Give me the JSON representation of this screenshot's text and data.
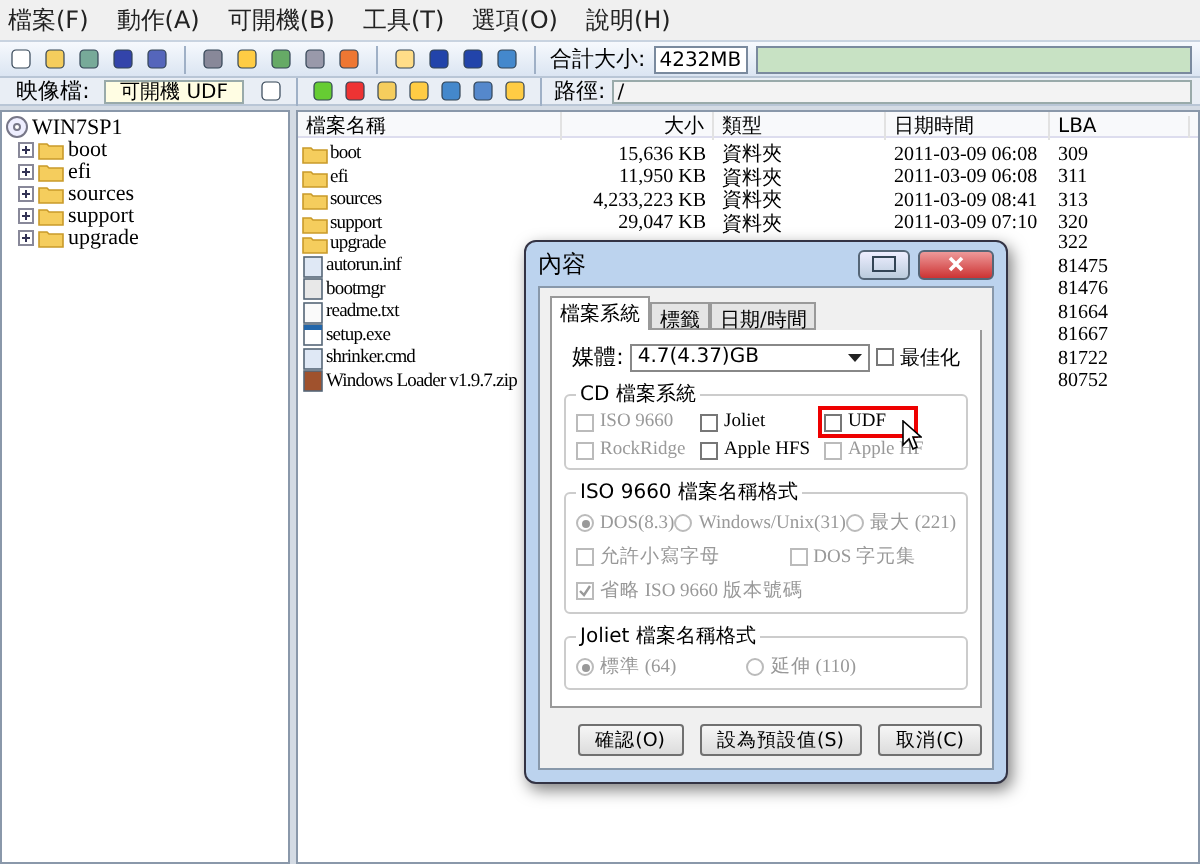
{
  "menu": [
    "檔案(F)",
    "動作(A)",
    "可開機(B)",
    "工具(T)",
    "選項(O)",
    "說明(H)"
  ],
  "toolbar": {
    "total_label": "合計大小:",
    "total_value": "4232MB",
    "level": 1
  },
  "image_bar": {
    "label": "映像檔:",
    "image_type": "可開機 UDF",
    "path_label": "路徑:",
    "path": "/"
  },
  "tree": {
    "label": "WIN7SP1",
    "children": [
      {
        "label": "boot",
        "expanded": false
      },
      {
        "label": "efi",
        "expanded": false
      },
      {
        "label": "sources",
        "expanded": false
      },
      {
        "label": "support",
        "expanded": false
      },
      {
        "label": "upgrade",
        "expanded": false
      }
    ]
  },
  "table": {
    "columns": [
      "檔案名稱",
      "大小",
      "類型",
      "日期時間",
      "LBA"
    ],
    "rows": [
      {
        "kind": "folder",
        "name": "boot",
        "size": "15,636 KB",
        "type": "資料夾",
        "date": "2011-03-09 06:08",
        "lba": "309"
      },
      {
        "kind": "folder",
        "name": "efi",
        "size": "11,950 KB",
        "type": "資料夾",
        "date": "2011-03-09 06:08",
        "lba": "311"
      },
      {
        "kind": "folder",
        "name": "sources",
        "size": "4,233,223 KB",
        "type": "資料夾",
        "date": "2011-03-09 08:41",
        "lba": "313"
      },
      {
        "kind": "folder",
        "name": "support",
        "size": "29,047 KB",
        "type": "資料夾",
        "date": "2011-03-09 07:10",
        "lba": "320"
      },
      {
        "kind": "folder",
        "name": "upgrade",
        "lba": "322"
      },
      {
        "kind": "settings",
        "name": "autorun.inf",
        "lba": "81475"
      },
      {
        "kind": "binary",
        "name": "bootmgr",
        "lba": "81476"
      },
      {
        "kind": "text",
        "name": "readme.txt",
        "lba": "81664"
      },
      {
        "kind": "app",
        "name": "setup.exe",
        "lba": "81667"
      },
      {
        "kind": "script",
        "name": "shrinker.cmd",
        "lba": "81722"
      },
      {
        "kind": "archive",
        "name": "Windows Loader v1.9.7.zip",
        "lba": "80752"
      }
    ]
  },
  "dialog": {
    "title": "內容",
    "tabs": [
      {
        "label": "檔案系統",
        "selected": true
      },
      {
        "label": "標籤",
        "selected": false
      },
      {
        "label": "日期/時間",
        "selected": false
      }
    ],
    "media_label": "媒體:",
    "media_value": "4.7(4.37)GB",
    "optimize": {
      "label": "最佳化",
      "checked": false,
      "disabled": false
    },
    "cd_group": {
      "title": "CD 檔案系統",
      "options": [
        {
          "label": "ISO 9660",
          "checked": false,
          "disabled": true,
          "highlighted": false
        },
        {
          "label": "Joliet",
          "checked": false,
          "disabled": false,
          "highlighted": false
        },
        {
          "label": "UDF",
          "checked": false,
          "disabled": false,
          "highlighted": true
        },
        {
          "label": "RockRidge",
          "checked": false,
          "disabled": true,
          "highlighted": false
        },
        {
          "label": "Apple HFS",
          "checked": false,
          "disabled": false,
          "highlighted": false
        },
        {
          "label": "Apple HF",
          "checked": false,
          "disabled": true,
          "highlighted": false
        }
      ]
    },
    "iso_group": {
      "title": "ISO 9660 檔案名稱格式",
      "radios": [
        {
          "label": "DOS(8.3)",
          "selected": true
        },
        {
          "label": "Windows/Unix(31)",
          "selected": false
        },
        {
          "label": "最大 (221)",
          "selected": false
        }
      ],
      "checks": [
        {
          "label": "允許小寫字母",
          "checked": false
        },
        {
          "label": "DOS 字元集",
          "checked": false
        },
        {
          "label": "省略 ISO 9660 版本號碼",
          "checked": true
        }
      ]
    },
    "joliet_group": {
      "title": "Joliet 檔案名稱格式",
      "radios": [
        {
          "label": "標準 (64)",
          "selected": true
        },
        {
          "label": "延伸 (110)",
          "selected": false
        }
      ]
    },
    "buttons": [
      "確認(O)",
      "設為預設值(S)",
      "取消(C)"
    ]
  }
}
